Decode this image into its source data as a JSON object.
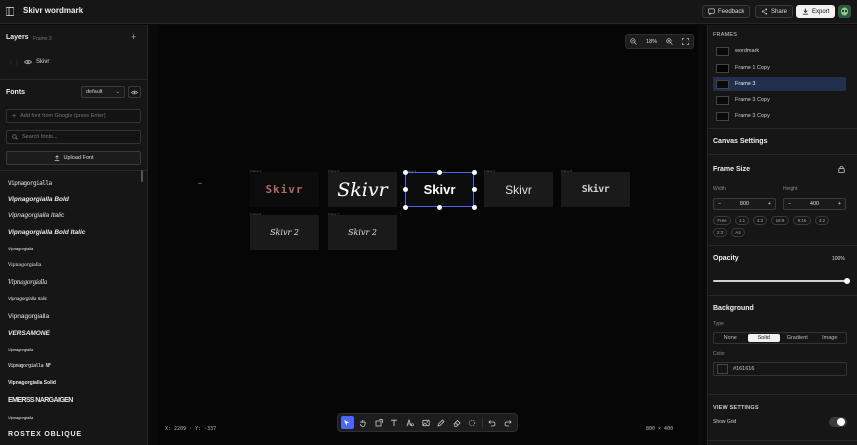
{
  "topbar": {
    "title": "Skivr wordmark",
    "feedback": "Feedback",
    "share": "Share",
    "export": "Export"
  },
  "layers": {
    "title": "Layers",
    "subtitle": "Frame 3",
    "items": [
      {
        "name": "Skivr"
      }
    ]
  },
  "fonts": {
    "title": "Fonts",
    "filter_value": "default",
    "add_placeholder": "Add font from Google (press Enter)",
    "search_placeholder": "Search fonts...",
    "upload_label": "Upload Font",
    "list": [
      "Vipnagorgialla",
      "Vipnagorgialla Bold",
      "Vipnagorgialla Italic",
      "Vipnagorgialla Bold Italic",
      "Vipnagorgialla",
      "Vipnagorgialla",
      "Vipnagorgialla",
      "Vipnagorgialla Italic",
      "Vipnagorgialla",
      "VERSAMONE",
      "Vipnagorgialla",
      "Vipnagorgialla NF",
      "Vipnagorgialla Solid",
      "EMERSS NARGAIGEN",
      "Vipnagorgialla",
      "ROSTEX OBLIQUE"
    ]
  },
  "canvas": {
    "zoom": "18%",
    "coords": "X: 2209 · Y: -337",
    "dims": "800 × 400",
    "frames": [
      {
        "label": "Frame 1",
        "text": "Skivr",
        "color": "#b06a5e"
      },
      {
        "label": "Frame 2",
        "text": "Skivr",
        "color": "#ffffff"
      },
      {
        "label": "Frame 3",
        "text": "Skivr",
        "color": "#ffffff"
      },
      {
        "label": "Frame 4",
        "text": "Skivr",
        "color": "#e0e0e0"
      },
      {
        "label": "Frame 5",
        "text": "Skivr",
        "color": "#cfcfcf"
      },
      {
        "label": "Frame 6",
        "text": "Skivr 2",
        "color": "#e0e0e0"
      },
      {
        "label": "Frame 7",
        "text": "Skivr 2",
        "color": "#e0e0e0"
      }
    ]
  },
  "right": {
    "frames_title": "FRAMES",
    "frames": [
      "wordmark",
      "Frame 1 Copy",
      "Frame 3",
      "Frame 3 Copy",
      "Frame 3 Copy"
    ],
    "canvas_settings": "Canvas Settings",
    "frame_size": "Frame Size",
    "width_label": "Width",
    "height_label": "Height",
    "width": "800",
    "height": "400",
    "presets": [
      "Free",
      "1:1",
      "4:3",
      "16:9",
      "9:16",
      "3:2",
      "2:3",
      "A4"
    ],
    "opacity_label": "Opacity",
    "opacity_value": "100%",
    "opacity": 100,
    "background_title": "Background",
    "type_label": "Type",
    "types": [
      "None",
      "Solid",
      "Gradient",
      "Image"
    ],
    "type_selected": "Solid",
    "color_label": "Color",
    "color_value": "#161616",
    "view_settings": "VIEW SETTINGS",
    "show_grid": "Show Grid"
  },
  "colors": {
    "accent": "#4b67ff",
    "panel": "#161616",
    "canvas": "#060606"
  }
}
